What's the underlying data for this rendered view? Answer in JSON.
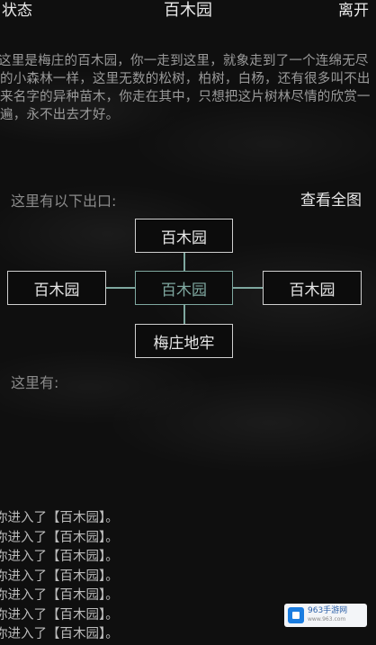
{
  "header": {
    "status_label": "状态",
    "title": "百木园",
    "leave_label": "离开"
  },
  "description": "这里是梅庄的百木园，你一走到这里，就象走到了一个连绵无尽的小森林一样，这里无数的松树，柏树，白杨，还有很多叫不出来名字的异种苗木，你走在其中，只想把这片树林尽情的欣赏一遍，永不出去才好。",
  "exits": {
    "label": "这里有以下出口:",
    "view_map_label": "查看全图",
    "north": "百木园",
    "west": "百木园",
    "center": "百木园",
    "east": "百木园",
    "south": "梅庄地牢"
  },
  "here": {
    "label": "这里有:"
  },
  "log": [
    "你进入了【百木园】。",
    "你进入了【百木园】。",
    "你进入了【百木园】。",
    "你进入了【百木园】。",
    "你进入了【百木园】。",
    "你进入了【百木园】。",
    "你进入了【百木园】。"
  ],
  "watermark": {
    "text": "963手游网",
    "sub": "www.963.com"
  },
  "colors": {
    "accent": "#7fa8a0",
    "background": "#0f0f0f"
  }
}
